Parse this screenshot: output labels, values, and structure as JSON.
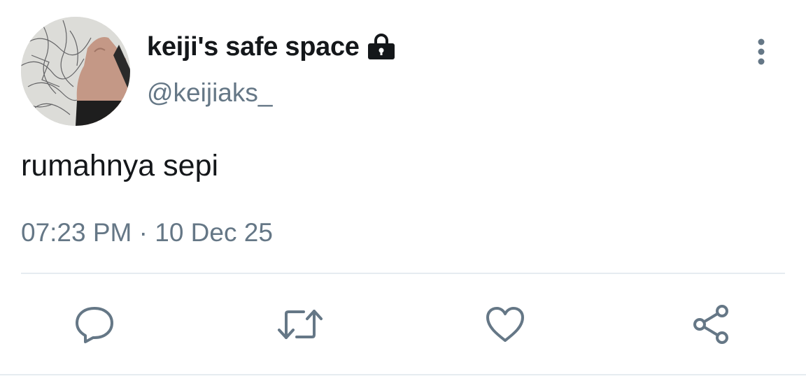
{
  "tweet": {
    "display_name": "keiji's safe space",
    "handle": "@keijiaks_",
    "text": "rumahnya sepi",
    "timestamp": "07:23 PM · 10 Dec 25",
    "protected": true
  },
  "icons": {
    "lock": "lock-icon",
    "more": "more-vertical-icon",
    "reply": "reply-icon",
    "retweet": "retweet-icon",
    "like": "heart-icon",
    "share": "share-icon"
  },
  "colors": {
    "text_primary": "#14171a",
    "text_secondary": "#657786",
    "divider": "#e6ecf0",
    "icon": "#657786"
  }
}
